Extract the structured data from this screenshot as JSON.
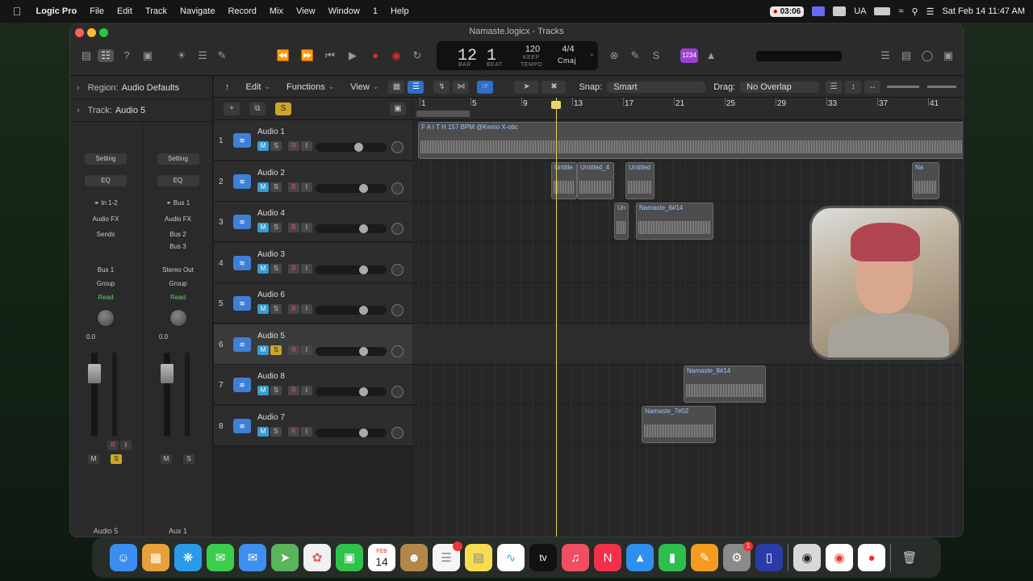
{
  "menubar": {
    "app": "Logic Pro",
    "items": [
      "File",
      "Edit",
      "Track",
      "Navigate",
      "Record",
      "Mix",
      "View",
      "Window",
      "1",
      "Help"
    ],
    "record_time": "03:06",
    "input": "UA",
    "datetime": "Sat Feb 14  11:47 AM"
  },
  "window": {
    "title": "Namaste.logicx - Tracks"
  },
  "lcd": {
    "bar": "12",
    "beat": "1",
    "bar_label": "BAR",
    "beat_label": "BEAT",
    "tempo": "120",
    "tempo_mode": "KEEP",
    "tempo_label": "TEMPO",
    "signature": "4/4",
    "key": "Cmaj"
  },
  "count_in": "1234",
  "inspector": {
    "region_label": "Region:",
    "region_value": "Audio Defaults",
    "track_label": "Track:",
    "track_value": "Audio 5",
    "strip1": {
      "setting": "Setting",
      "eq": "EQ",
      "input": "In 1-2",
      "audio_fx": "Audio FX",
      "sends": "Sends",
      "output": "Bus 1",
      "group": "Group",
      "automation": "Read",
      "volume": "0.0",
      "name": "Audio 5",
      "mute": "M",
      "solo": "S",
      "rec": "R",
      "input_mon": "I"
    },
    "strip2": {
      "setting": "Setting",
      "eq": "EQ",
      "input": "Bus 1",
      "audio_fx": "Audio FX",
      "send1": "Bus 2",
      "send2": "Bus 3",
      "output": "Stereo Out",
      "group": "Group",
      "automation": "Read",
      "volume": "0.0",
      "name": "Aux 1",
      "mute": "M",
      "solo": "S"
    }
  },
  "toolbar": {
    "edit": "Edit",
    "functions": "Functions",
    "view": "View",
    "snap_label": "Snap:",
    "snap_value": "Smart",
    "drag_label": "Drag:",
    "drag_value": "No Overlap"
  },
  "ruler": [
    "1",
    "5",
    "9",
    "13",
    "17",
    "21",
    "25",
    "29",
    "33",
    "37",
    "41"
  ],
  "tracks": [
    {
      "num": "1",
      "name": "Audio 1",
      "m": "M",
      "s": "S",
      "r": "R",
      "i": "I",
      "vol": 0.62
    },
    {
      "num": "2",
      "name": "Audio 2",
      "m": "M",
      "s": "S",
      "r": "R",
      "i": "I",
      "vol": 0.7
    },
    {
      "num": "3",
      "name": "Audio 4",
      "m": "M",
      "s": "S",
      "r": "R",
      "i": "I",
      "vol": 0.7
    },
    {
      "num": "4",
      "name": "Audio 3",
      "m": "M",
      "s": "S",
      "r": "R",
      "i": "I",
      "vol": 0.7
    },
    {
      "num": "5",
      "name": "Audio 6",
      "m": "M",
      "s": "S",
      "r": "R",
      "i": "I",
      "vol": 0.7
    },
    {
      "num": "6",
      "name": "Audio 5",
      "m": "M",
      "s": "S",
      "r": "R",
      "i": "I",
      "vol": 0.7
    },
    {
      "num": "7",
      "name": "Audio 8",
      "m": "M",
      "s": "S",
      "r": "R",
      "i": "I",
      "vol": 0.7
    },
    {
      "num": "8",
      "name": "Audio 7",
      "m": "M",
      "s": "S",
      "r": "R",
      "i": "I",
      "vol": 0.7
    }
  ],
  "regions": {
    "r1": "F A I T H 157 BPM @Kemo X-otic",
    "r2a": "Untitle",
    "r2b": "Untitled_4",
    "r2c": "Untitled",
    "r2d": "Na",
    "r3a": "Un",
    "r3b": "Namaste_6#14",
    "r7": "Namaste_8#14",
    "r8": "Namaste_7#02"
  },
  "dock": {
    "calendar_month": "FEB",
    "calendar_day": "14",
    "tv": "tv"
  }
}
